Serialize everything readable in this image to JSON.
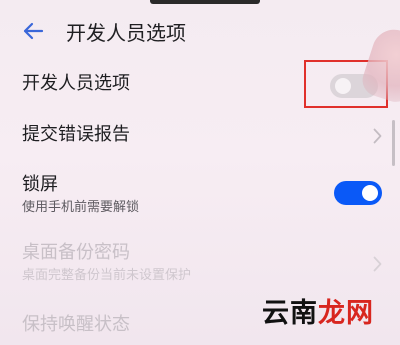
{
  "header": {
    "title": "开发人员选项"
  },
  "rows": {
    "dev_options": {
      "title": "开发人员选项",
      "toggle_on": false
    },
    "bug_report": {
      "title": "提交错误报告"
    },
    "lock_screen": {
      "title": "锁屏",
      "subtitle": "使用手机前需要解锁",
      "toggle_on": true
    },
    "desktop_backup_password": {
      "title": "桌面备份密码",
      "subtitle": "桌面完整备份当前未设置保护",
      "enabled": false
    },
    "stay_awake": {
      "title": "保持唤醒状态",
      "enabled": false
    }
  },
  "watermark": {
    "text_black": "云南",
    "text_red": "龙网"
  },
  "colors": {
    "accent": "#0a59f7",
    "highlight": "#e0302b",
    "background": "#f6ecf2"
  },
  "icons": {
    "back": "back-arrow-icon",
    "chevron": "chevron-right-icon"
  }
}
